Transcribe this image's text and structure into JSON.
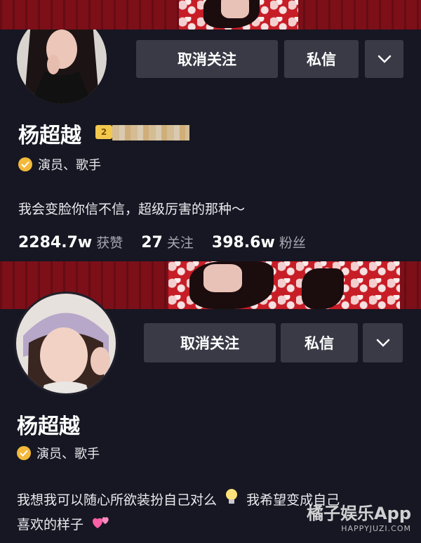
{
  "profile_top": {
    "name": "杨超越",
    "level_badge": "2",
    "verification": "演员、歌手",
    "bio": "我会变脸你信不信，超级厉害的那种～",
    "unfollow_label": "取消关注",
    "message_label": "私信",
    "stats": [
      {
        "value": "2284.7w",
        "label": "获赞"
      },
      {
        "value": "27",
        "label": "关注"
      },
      {
        "value": "398.6w",
        "label": "粉丝"
      }
    ]
  },
  "profile_bottom": {
    "name": "杨超越",
    "verification": "演员、歌手",
    "bio_line1": "我想我可以随心所欲装扮自己对么",
    "bio_line1_tail": "我希望变成自己",
    "bio_line2": "喜欢的样子",
    "unfollow_label": "取消关注",
    "message_label": "私信"
  },
  "watermark": {
    "title": "橘子娱乐App",
    "url": "HAPPYJUZI.COM"
  },
  "icons": {
    "dropdown": "chevron-down-icon",
    "verified": "verified-badge-icon",
    "bulb": "light-bulb-emoji",
    "hearts": "two-hearts-emoji"
  },
  "colors": {
    "background": "#161722",
    "button": "#393a46",
    "verified": "#f3b93a",
    "secondary_text": "#a7a8b2"
  }
}
